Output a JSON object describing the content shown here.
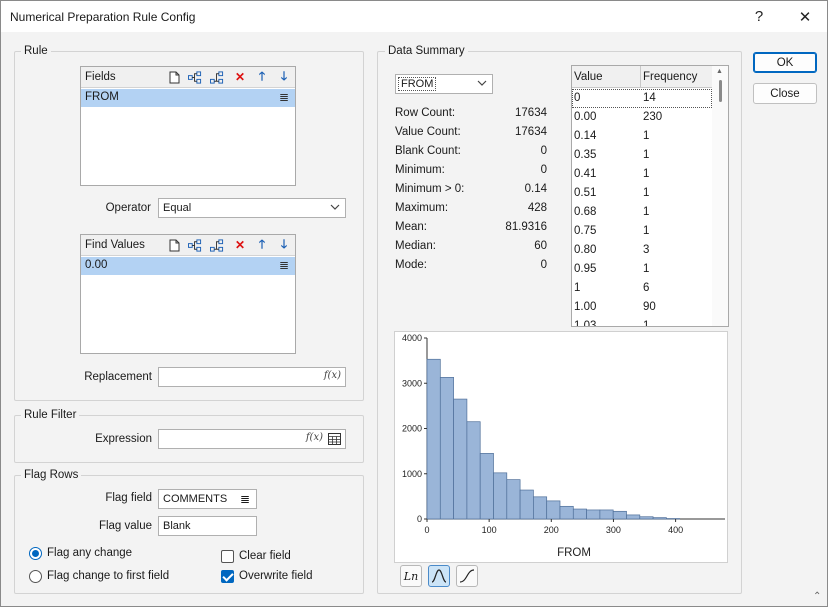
{
  "window": {
    "title": "Numerical Preparation Rule Config",
    "help": "?",
    "close": "✕"
  },
  "buttons": {
    "ok": "OK",
    "close": "Close"
  },
  "rule": {
    "group_label": "Rule",
    "fields": {
      "header": "Fields",
      "items": [
        "FROM"
      ]
    },
    "operator_label": "Operator",
    "operator_value": "Equal",
    "find_values": {
      "header": "Find Values",
      "items": [
        "0.00"
      ]
    },
    "replacement_label": "Replacement",
    "replacement_value": ""
  },
  "rule_filter": {
    "group_label": "Rule Filter",
    "expression_label": "Expression",
    "expression_value": ""
  },
  "flag_rows": {
    "group_label": "Flag Rows",
    "flag_field_label": "Flag field",
    "flag_field_value": "COMMENTS",
    "flag_value_label": "Flag value",
    "flag_value_value": "Blank",
    "radio_any_change": "Flag any change",
    "radio_first_field": "Flag change to first field",
    "radio_selected": "any_change",
    "clear_field_label": "Clear field",
    "clear_field_checked": false,
    "overwrite_field_label": "Overwrite field",
    "overwrite_field_checked": true
  },
  "data_summary": {
    "group_label": "Data Summary",
    "field_select": "FROM",
    "stats": [
      {
        "key": "Row Count:",
        "value": "17634"
      },
      {
        "key": "Value Count:",
        "value": "17634"
      },
      {
        "key": "Blank Count:",
        "value": "0"
      },
      {
        "key": "Minimum:",
        "value": "0"
      },
      {
        "key": "Minimum > 0:",
        "value": "0.14"
      },
      {
        "key": "Maximum:",
        "value": "428"
      },
      {
        "key": "Mean:",
        "value": "81.9316"
      },
      {
        "key": "Median:",
        "value": "60"
      },
      {
        "key": "Mode:",
        "value": "0"
      }
    ],
    "frequency_table": {
      "headers": [
        "Value",
        "Frequency"
      ],
      "rows": [
        [
          "0",
          "14"
        ],
        [
          "0.00",
          "230"
        ],
        [
          "0.14",
          "1"
        ],
        [
          "0.35",
          "1"
        ],
        [
          "0.41",
          "1"
        ],
        [
          "0.51",
          "1"
        ],
        [
          "0.68",
          "1"
        ],
        [
          "0.75",
          "1"
        ],
        [
          "0.80",
          "3"
        ],
        [
          "0.95",
          "1"
        ],
        [
          "1",
          "6"
        ],
        [
          "1.00",
          "90"
        ],
        [
          "1.03",
          "1"
        ]
      ]
    },
    "plot_tools": {
      "ln": "Ln"
    }
  },
  "chart_data": {
    "type": "bar",
    "title": "",
    "xlabel": "FROM",
    "ylabel": "",
    "xlim": [
      0,
      428
    ],
    "ylim": [
      0,
      4000
    ],
    "x_ticks": [
      0,
      100,
      200,
      300,
      400
    ],
    "y_ticks": [
      0,
      1000,
      2000,
      3000,
      4000
    ],
    "bin_width": 21.4,
    "bin_starts": [
      0,
      21.4,
      42.8,
      64.2,
      85.6,
      107,
      128.4,
      149.8,
      171.2,
      192.6,
      214,
      235.4,
      256.8,
      278.2,
      299.6,
      321,
      342.4,
      363.8,
      385.2
    ],
    "values": [
      3530,
      3130,
      2650,
      2150,
      1450,
      1020,
      870,
      640,
      490,
      400,
      280,
      220,
      200,
      200,
      170,
      90,
      50,
      30,
      10
    ],
    "bar_color": "#9ab5d8",
    "grid": false,
    "legend": "none"
  }
}
